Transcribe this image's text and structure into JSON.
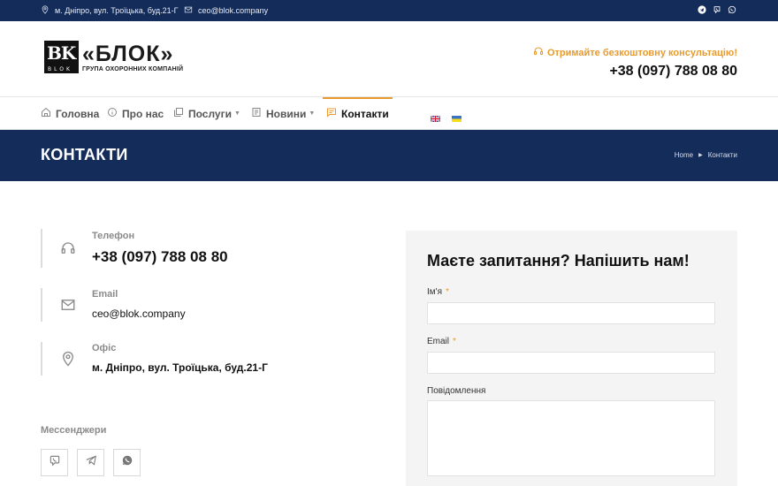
{
  "topbar": {
    "address": "м. Дніпро, вул. Троїцька, буд.21-Г",
    "email": "ceo@blok.company",
    "socials": [
      "telegram-icon",
      "viber-icon",
      "whatsapp-icon"
    ]
  },
  "header": {
    "logo_mark": "BK",
    "logo_mark_sub": "BLOK",
    "logo_title": "«БЛОК»",
    "logo_subtitle": "ГРУПА ОХОРОННИХ КОМПАНІЙ",
    "consult_text": "Отримайте безкоштовну консультацію!",
    "phone": "+38 (097) 788 08 80"
  },
  "nav": {
    "items": [
      {
        "label": "Головна",
        "icon": "home-icon"
      },
      {
        "label": "Про нас",
        "icon": "info-icon"
      },
      {
        "label": "Послуги",
        "icon": "services-icon"
      },
      {
        "label": "Новини",
        "icon": "news-icon"
      },
      {
        "label": "Контакти",
        "icon": "chat-icon"
      }
    ],
    "active": "Контакти"
  },
  "band": {
    "title": "КОНТАКТИ",
    "breadcrumb_home": "Home",
    "breadcrumb_current": "Контакти"
  },
  "contacts": {
    "phone_label": "Телефон",
    "phone_value": "+38 (097) 788 08 80",
    "email_label": "Email",
    "email_value": "ceo@blok.company",
    "office_label": "Офіс",
    "office_value": "м. Дніпро, вул. Троїцька, буд.21-Г",
    "messengers_label": "Мессенджери"
  },
  "form": {
    "title": "Маєте запитання? Напішить нам!",
    "name_label": "Ім'я",
    "email_label": "Email",
    "message_label": "Повідомлення",
    "required_mark": "*"
  },
  "colors": {
    "navy": "#142c5a",
    "accent": "#e89a2c"
  }
}
